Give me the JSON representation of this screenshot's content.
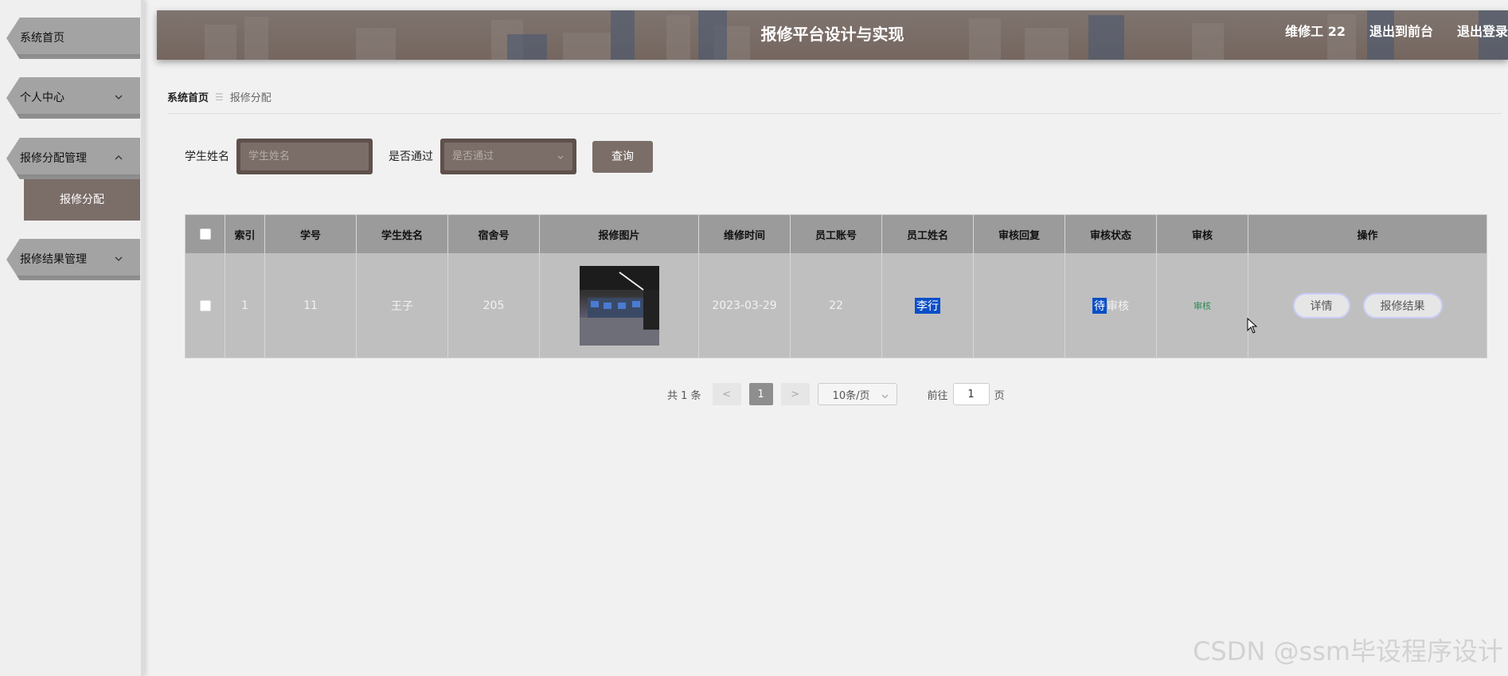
{
  "sidebar": {
    "items": [
      {
        "label": "系统首页"
      },
      {
        "label": "个人中心"
      },
      {
        "label": "报修分配管理"
      },
      {
        "label": "报修结果管理"
      }
    ],
    "sub_active": "报修分配"
  },
  "header": {
    "title": "报修平台设计与实现",
    "user": "维修工 22",
    "front": "退出到前台",
    "logout": "退出登录"
  },
  "breadcrumb": {
    "home": "系统首页",
    "sep": "☰",
    "current": "报修分配"
  },
  "search": {
    "name_label": "学生姓名",
    "name_placeholder": "学生姓名",
    "pass_label": "是否通过",
    "pass_placeholder": "是否通过",
    "query_button": "查询"
  },
  "table": {
    "headers": [
      "索引",
      "学号",
      "学生姓名",
      "宿舍号",
      "报修图片",
      "维修时间",
      "员工账号",
      "员工姓名",
      "审核回复",
      "审核状态",
      "审核",
      "操作"
    ],
    "rows": [
      {
        "index": "1",
        "student_id": "11",
        "student_name": "王子",
        "dorm": "205",
        "repair_time": "2023-03-29",
        "staff_account": "22",
        "staff_name": "李行",
        "reply": "",
        "status_hl": "待",
        "status_rest": "审核",
        "audit": "审核",
        "btn_detail": "详情",
        "btn_result": "报修结果"
      }
    ]
  },
  "pagination": {
    "total": "共 1 条",
    "prev": "<",
    "current": "1",
    "next": ">",
    "size": "10条/页",
    "goto_label": "前往",
    "goto_value": "1",
    "goto_unit": "页"
  },
  "watermark": "CSDN @ssm毕设程序设计"
}
